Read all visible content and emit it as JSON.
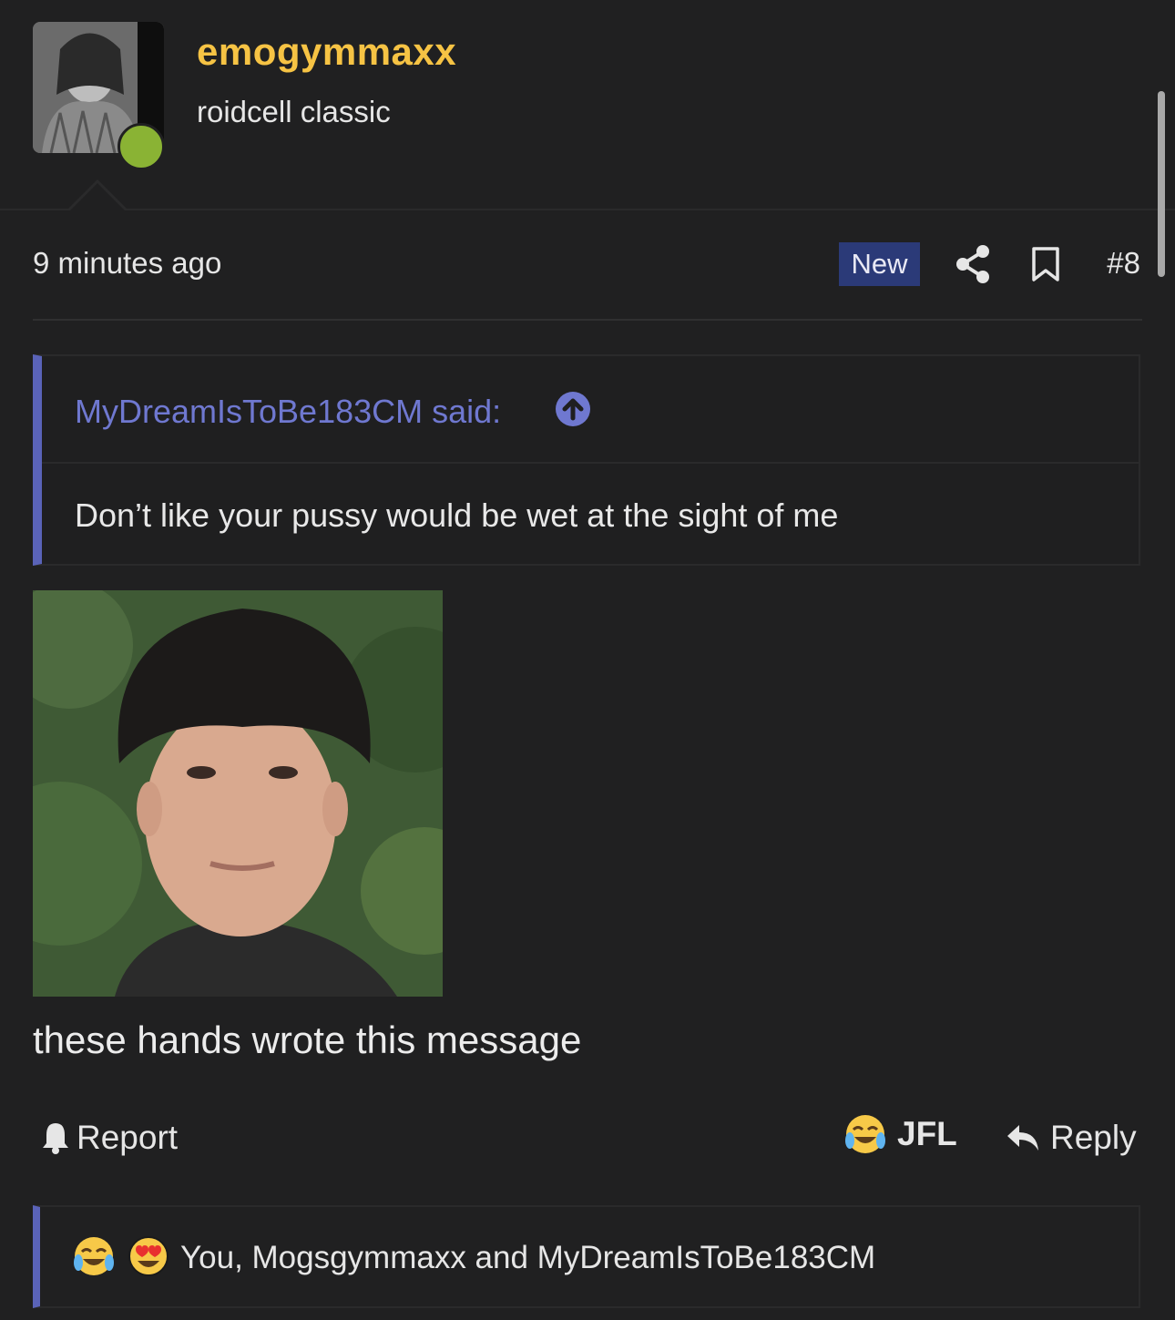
{
  "user": {
    "name": "emogymmaxx",
    "title": "roidcell classic",
    "status_color": "#8ab334",
    "name_color": "#f6c344"
  },
  "post": {
    "time": "9 minutes ago",
    "badge": "New",
    "number": "#8",
    "message": "these hands wrote this message"
  },
  "quote": {
    "author": "MyDreamIsToBe183CM said:",
    "body": "Don’t like your pussy would be wet at the sight of me",
    "accent_color": "#5a63b8"
  },
  "actions": {
    "report": "Report",
    "react": "JFL",
    "reply": "Reply"
  },
  "reactions": {
    "summary": "You, Mogsgymmaxx and MyDreamIsToBe183CM",
    "icons": [
      "joy-emoji-icon",
      "heart-eyes-emoji-icon"
    ]
  }
}
